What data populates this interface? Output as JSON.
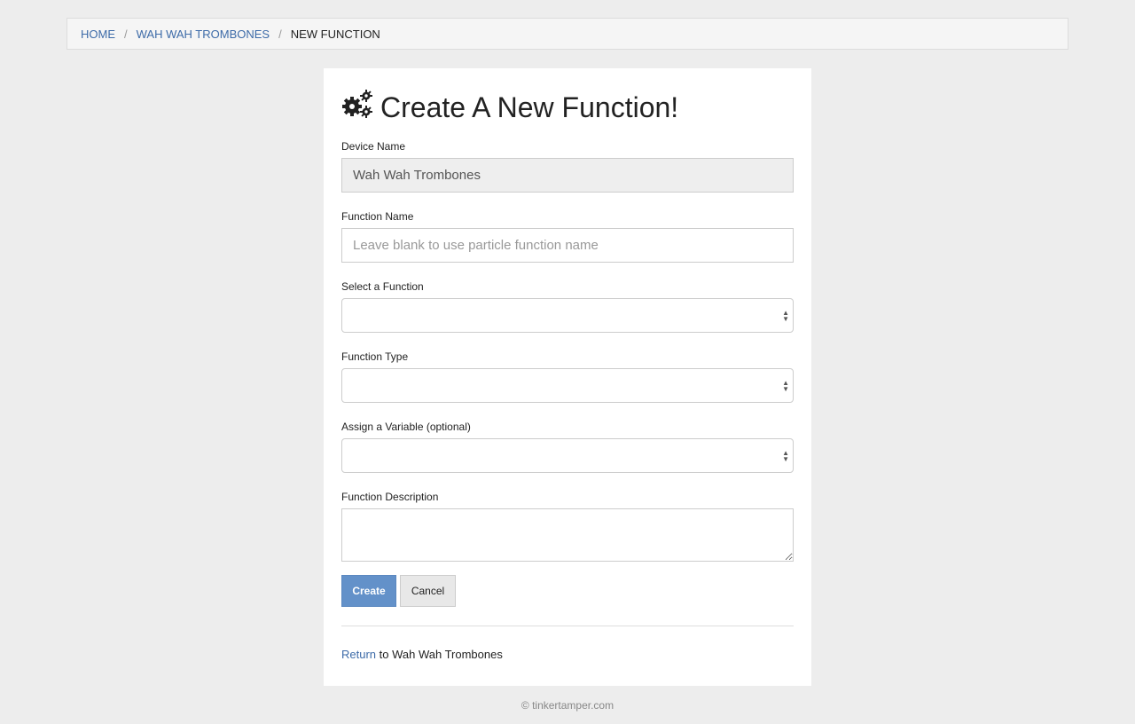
{
  "breadcrumb": {
    "home": "HOME",
    "device": "WAH WAH TROMBONES",
    "current": "NEW FUNCTION",
    "separator": "/"
  },
  "page": {
    "title": "Create A New Function!",
    "title_icon": "gears-icon"
  },
  "form": {
    "device_name": {
      "label": "Device Name",
      "value": "Wah Wah Trombones"
    },
    "function_name": {
      "label": "Function Name",
      "placeholder": "Leave blank to use particle function name",
      "value": ""
    },
    "select_function": {
      "label": "Select a Function",
      "value": ""
    },
    "function_type": {
      "label": "Function Type",
      "value": ""
    },
    "assign_variable": {
      "label": "Assign a Variable (optional)",
      "value": ""
    },
    "function_description": {
      "label": "Function Description",
      "value": ""
    },
    "create_label": "Create",
    "cancel_label": "Cancel"
  },
  "return_link": {
    "link_text": "Return",
    "rest_text": " to Wah Wah Trombones"
  },
  "footer": {
    "text": "© tinkertamper.com"
  },
  "colors": {
    "link": "#3d6ba8",
    "primary_button": "#6391c9",
    "background": "#ededed"
  }
}
